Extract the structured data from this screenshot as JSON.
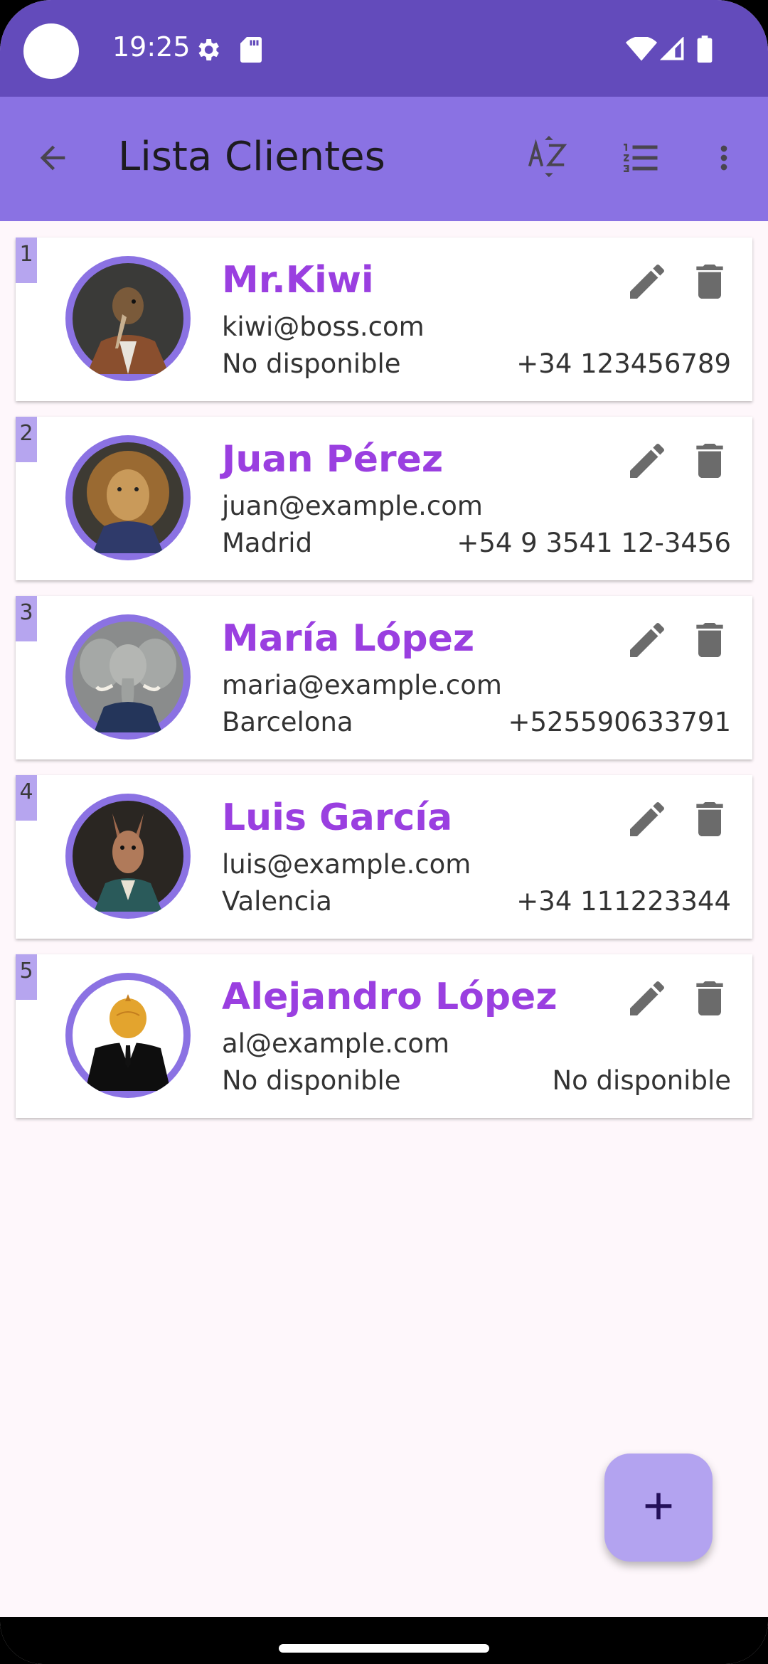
{
  "status_bar": {
    "time": "19:25",
    "icons": [
      "settings-gear-icon",
      "sd-card-icon",
      "wifi-icon",
      "signal-icon",
      "battery-icon"
    ]
  },
  "app_bar": {
    "title": "Lista Clientes",
    "actions": [
      "back-arrow-icon",
      "sort-az-icon",
      "numbered-list-icon",
      "overflow-menu-icon"
    ]
  },
  "clients": [
    {
      "index": "1",
      "name": "Mr.Kiwi",
      "email": "kiwi@boss.com",
      "city": "No disponible",
      "phone": "+34 123456789"
    },
    {
      "index": "2",
      "name": "Juan Pérez",
      "email": "juan@example.com",
      "city": "Madrid",
      "phone": "+54 9 3541 12-3456"
    },
    {
      "index": "3",
      "name": "María López",
      "email": "maria@example.com",
      "city": "Barcelona",
      "phone": "+525590633791"
    },
    {
      "index": "4",
      "name": "Luis García",
      "email": "luis@example.com",
      "city": "Valencia",
      "phone": "+34 111223344"
    },
    {
      "index": "5",
      "name": "Alejandro López",
      "email": "al@example.com",
      "city": "No disponible",
      "phone": "No disponible"
    }
  ],
  "colors": {
    "status_bar": "#634bbb",
    "app_bar": "#8a72e3",
    "name_text": "#9a3fe0",
    "index_badge": "#b6a5ef",
    "fab": "#b3a3f0",
    "background": "#fef7fb"
  },
  "fab": {
    "icon": "plus-icon"
  }
}
